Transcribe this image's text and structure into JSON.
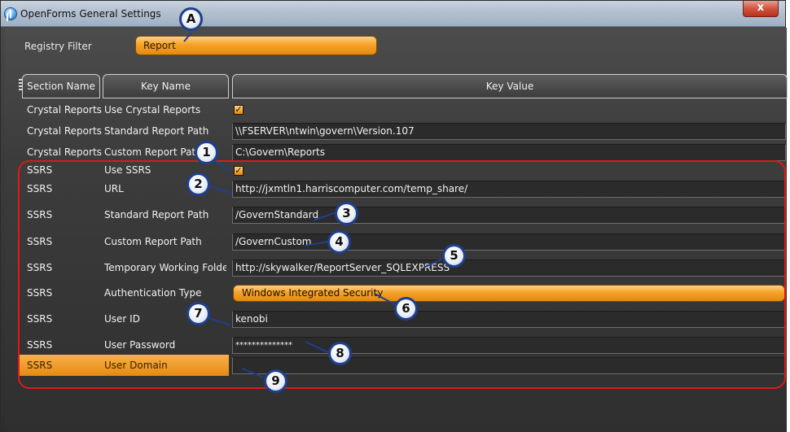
{
  "window": {
    "title": "OpenForms General Settings",
    "close_label": "x"
  },
  "filter": {
    "label": "Registry Filter",
    "value": "Report"
  },
  "columns": [
    "Section Name",
    "Key Name",
    "Key Value"
  ],
  "rows": [
    {
      "section": "Crystal Reports",
      "key": "Use Crystal Reports",
      "value": "",
      "type": "checkbox",
      "checked": true
    },
    {
      "section": "Crystal Reports",
      "key": "Standard Report Path",
      "value": "\\\\FSERVER\\ntwin\\govern\\Version.107",
      "type": "text"
    },
    {
      "section": "Crystal Reports",
      "key": "Custom Report Path",
      "value": "C:\\Govern\\Reports",
      "type": "text"
    },
    {
      "section": "SSRS",
      "key": "Use SSRS",
      "value": "",
      "type": "checkbox",
      "checked": true
    },
    {
      "section": "SSRS",
      "key": "URL",
      "value": "http://jxmtln1.harriscomputer.com/temp_share/",
      "type": "text"
    },
    {
      "section": "SSRS",
      "key": "Standard Report Path",
      "value": "/GovernStandard",
      "type": "text"
    },
    {
      "section": "SSRS",
      "key": "Custom Report Path",
      "value": "/GovernCustom",
      "type": "text"
    },
    {
      "section": "SSRS",
      "key": "Temporary Working Folder",
      "value": "http://skywalker/ReportServer_SQLEXPRESS",
      "type": "text"
    },
    {
      "section": "SSRS",
      "key": "Authentication Type",
      "value": "Windows Integrated Security",
      "type": "dropdown"
    },
    {
      "section": "SSRS",
      "key": "User ID",
      "value": "kenobi",
      "type": "text"
    },
    {
      "section": "SSRS",
      "key": "User Password",
      "value": "**************",
      "type": "password"
    },
    {
      "section": "SSRS",
      "key": "User Domain",
      "value": "",
      "type": "text",
      "selected": true
    }
  ],
  "callouts": [
    "A",
    "1",
    "2",
    "3",
    "4",
    "5",
    "6",
    "7",
    "8",
    "9"
  ],
  "colors": {
    "accent_orange": "#f5a226",
    "highlight_red": "#e01818",
    "callout_border": "#1f3f8f",
    "background_dark": "#3a3a3a"
  }
}
